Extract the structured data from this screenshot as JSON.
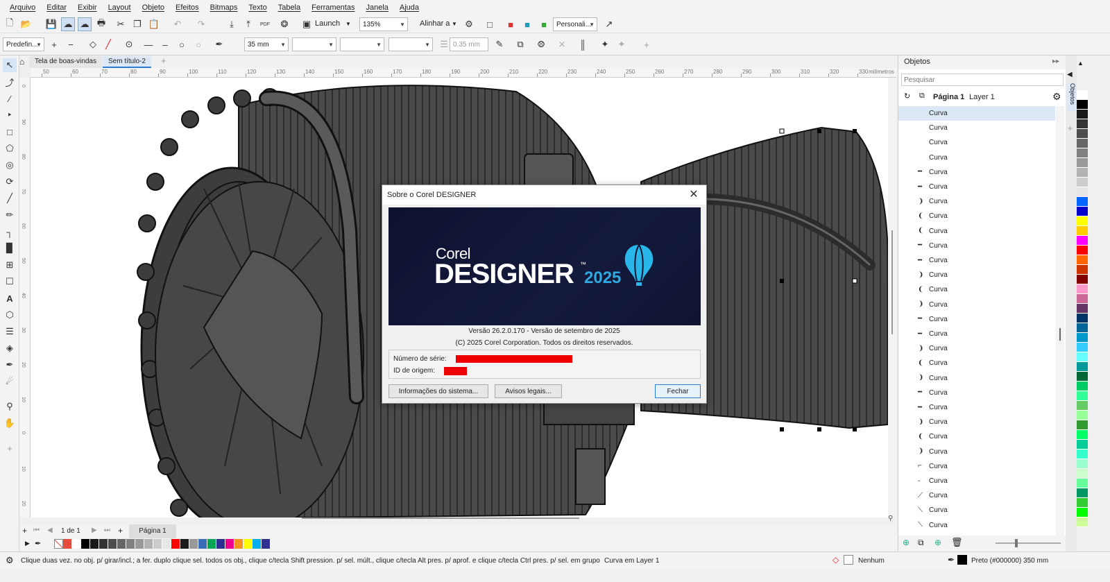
{
  "menu": [
    "Arquivo",
    "Editar",
    "Exibir",
    "Layout",
    "Objeto",
    "Efeitos",
    "Bitmaps",
    "Texto",
    "Tabela",
    "Ferramentas",
    "Janela",
    "Ajuda"
  ],
  "toolbar": {
    "launch_label": "Launch",
    "zoom_value": "135%",
    "align_label": "Alinhar a",
    "workspace_value": "Personali..."
  },
  "property_bar": {
    "preset_value": "Predefin...",
    "width_value": "35 mm",
    "outline_width": "0.35 mm"
  },
  "doc_tabs": [
    {
      "label": "Tela de boas-vindas",
      "active": false
    },
    {
      "label": "Sem título-2",
      "active": true
    }
  ],
  "ruler": {
    "ticks": [
      "50",
      "60",
      "70",
      "80",
      "90",
      "100",
      "110",
      "120",
      "130",
      "140",
      "150",
      "160",
      "170",
      "180",
      "190",
      "200",
      "210",
      "220",
      "230",
      "240",
      "250",
      "260",
      "270",
      "280",
      "290",
      "300",
      "310",
      "320",
      "330"
    ],
    "unit": "milímetros",
    "vticks": [
      "0",
      "90",
      "80",
      "70",
      "60",
      "50",
      "40",
      "30",
      "20",
      "10",
      "0",
      "10",
      "20"
    ]
  },
  "page_nav": {
    "counter": "1 de 1",
    "page_tab": "Página 1"
  },
  "objects_panel": {
    "title": "Objetos",
    "search_placeholder": "Pesquisar",
    "page_label": "Página 1",
    "layer_label": "Layer 1",
    "side_tab": "Objetos",
    "items": [
      "Curva",
      "Curva",
      "Curva",
      "Curva",
      "Curva",
      "Curva",
      "Curva",
      "Curva",
      "Curva",
      "Curva",
      "Curva",
      "Curva",
      "Curva",
      "Curva",
      "Curva",
      "Curva",
      "Curva",
      "Curva",
      "Curva",
      "Curva",
      "Curva",
      "Curva",
      "Curva",
      "Curva",
      "Curva",
      "Curva",
      "Curva",
      "Curva",
      "Curva"
    ]
  },
  "dialog": {
    "title": "Sobre o Corel DESIGNER",
    "logo_brand": "Corel",
    "logo_product": "DESIGNER",
    "logo_year": "2025",
    "logo_tm": "™",
    "version": "Versão 26.2.0.170 - Versão de setembro de 2025",
    "copyright": "(C) 2025 Corel Corporation.  Todos os direitos reservados.",
    "serial_label": "Número de série:",
    "origin_label": "ID de origem:",
    "sysinfo_button": "Informações do sistema...",
    "legal_button": "Avisos legais...",
    "close_button": "Fechar"
  },
  "status": {
    "hint": "Clique duas vez. no obj. p/ girar/incl.; a fer. duplo clique sel. todos os obj., clique c/tecla Shift pression. p/ sel. múlt., clique c/tecla Alt pres. p/ aprof. e clique c/tecla Ctrl pres. p/ sel. em grupo",
    "selection": "Curva em Layer 1",
    "fill_label": "Nenhum",
    "outline_label": "Preto (#000000)  350 mm"
  },
  "colors": {
    "accent": "#2b7cd3",
    "drawing_fill": "#4d4d4d",
    "redaction": "#ee0000",
    "splash_bg": "#121736",
    "balloon": "#29b6e8",
    "year": "#2fa9e0"
  },
  "palette_bottom": [
    "#ffffff",
    "#e84c3d",
    "#ffffff",
    "#000000",
    "#1a1a1a",
    "#333333",
    "#4d4d4d",
    "#666666",
    "#808080",
    "#999999",
    "#b3b3b3",
    "#cccccc",
    "#e6e6e6",
    "#ff0000",
    "#1a1a1a",
    "#999999",
    "#3a6fb7",
    "#00a651",
    "#2e3192",
    "#ec008c",
    "#f7941d",
    "#ffff00",
    "#00aeef",
    "#2e3192"
  ],
  "palette_side": [
    "#ffffff",
    "#000000",
    "#1a1a1a",
    "#333333",
    "#4d4d4d",
    "#666666",
    "#808080",
    "#999999",
    "#b3b3b3",
    "#cccccc",
    "#e6e6e6",
    "#0066ff",
    "#0000cc",
    "#ffff00",
    "#ffcc00",
    "#ff00ff",
    "#ff0000",
    "#ff6600",
    "#cc3300",
    "#800000",
    "#ff99cc",
    "#cc6699",
    "#663366",
    "#003366",
    "#006699",
    "#0099cc",
    "#33ccff",
    "#66ffff",
    "#009999",
    "#006633",
    "#00cc66",
    "#33ff99",
    "#66cc66",
    "#99ff99",
    "#339933",
    "#00ff66",
    "#00cc99",
    "#33ffcc",
    "#99ffcc",
    "#ccffcc",
    "#66ff99",
    "#009966",
    "#33cc33",
    "#00ff00",
    "#ccff99"
  ]
}
